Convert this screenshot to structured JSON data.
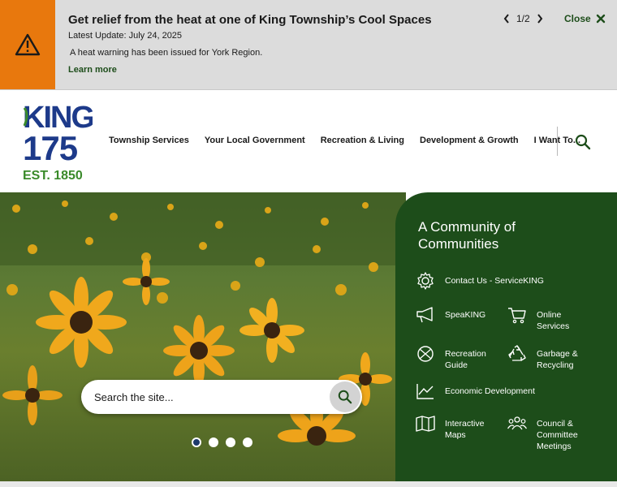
{
  "alert": {
    "title": "Get relief from the heat at one of King Township’s Cool Spaces",
    "date": "Latest Update: July 24, 2025",
    "message": "A heat warning has been issued for York Region.",
    "link": "Learn more",
    "pager": "1/2",
    "close": "Close",
    "icon": "warning-triangle-icon"
  },
  "logo": {
    "line1": "KING",
    "line2": "175",
    "line3": "EST. 1850",
    "colors": {
      "blue": "#1d3a8a",
      "green": "#3a8a2a"
    }
  },
  "nav": {
    "items": [
      "Township Services",
      "Your Local Government",
      "Recreation & Living",
      "Development & Growth",
      "I Want To..."
    ]
  },
  "search": {
    "placeholder": "Search the site..."
  },
  "carousel": {
    "slide_count": 4,
    "active_index": 0
  },
  "panel": {
    "title": "A Community of Communities",
    "links": [
      {
        "label": "Contact Us - ServiceKING",
        "icon": "gear-icon"
      },
      {
        "label": "SpeaKING",
        "icon": "megaphone-icon"
      },
      {
        "label": "Online Services",
        "icon": "cart-icon"
      },
      {
        "label": "Recreation Guide",
        "icon": "ball-icon"
      },
      {
        "label": "Garbage & Recycling",
        "icon": "recycle-icon"
      },
      {
        "label": "Economic Development",
        "icon": "chart-icon"
      },
      {
        "label": "Interactive Maps",
        "icon": "map-icon"
      },
      {
        "label": "Council & Committee Meetings",
        "icon": "people-icon"
      }
    ]
  },
  "colors": {
    "brand_green": "#1d4d1a",
    "alert_orange": "#e8780d",
    "alert_bg": "#dcdcdc"
  }
}
